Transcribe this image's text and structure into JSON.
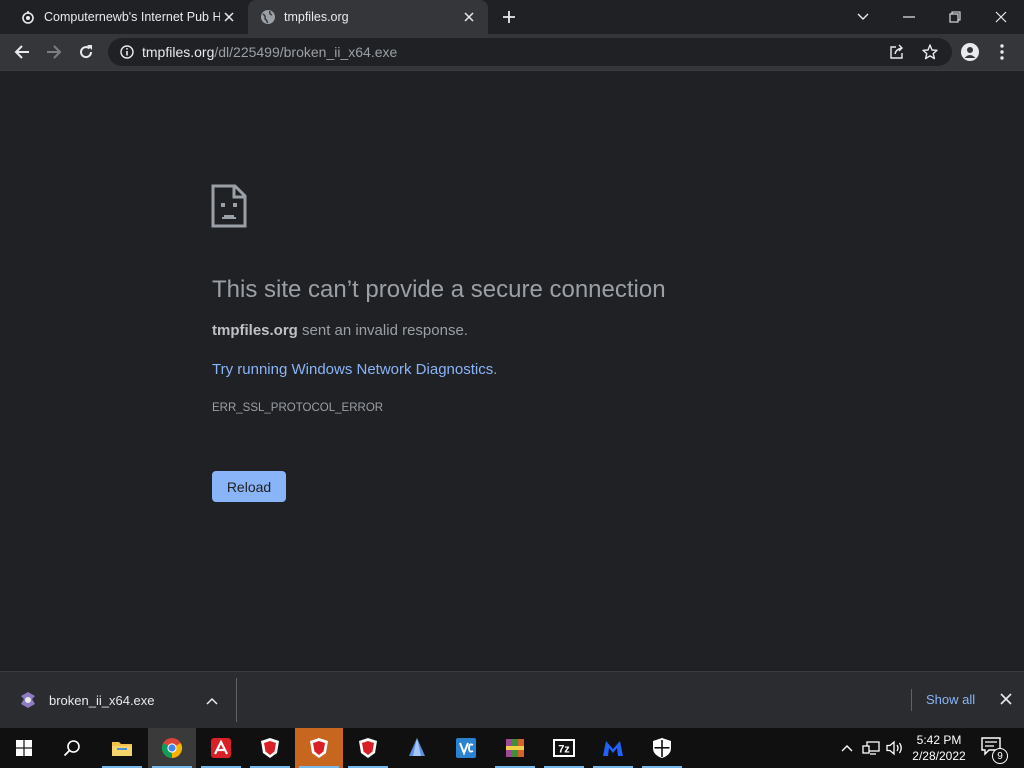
{
  "browser": {
    "tabs": [
      {
        "title": "Computernewb's Internet Pub H",
        "icon": "tor-onion-icon"
      },
      {
        "title": "tmpfiles.org",
        "icon": "globe-icon"
      }
    ],
    "address": {
      "domain": "tmpfiles.org",
      "path": "/dl/225499/broken_ii_x64.exe"
    }
  },
  "error_page": {
    "title": "This site can’t provide a secure connection",
    "host": "tmpfiles.org",
    "description": "sent an invalid response.",
    "link_prefix": "Try running ",
    "link_text": "Windows Network Diagnostics",
    "link_suffix": ".",
    "error_code": "ERR_SSL_PROTOCOL_ERROR",
    "reload_label": "Reload"
  },
  "downloads": {
    "filename": "broken_ii_x64.exe",
    "show_all_label": "Show all"
  },
  "taskbar": {
    "apps": [
      "file-explorer",
      "chrome",
      "avira",
      "brave",
      "brave",
      "brave",
      "app-launcher",
      "visual-studio-code",
      "winrar",
      "7-zip",
      "malwarebytes",
      "windows-security"
    ],
    "time": "5:42 PM",
    "date": "2/28/2022",
    "notification_count": "9"
  },
  "colors": {
    "page_bg": "#202124",
    "link": "#8ab4f8",
    "button": "#8ab4f8",
    "text": "#9aa0a6"
  }
}
